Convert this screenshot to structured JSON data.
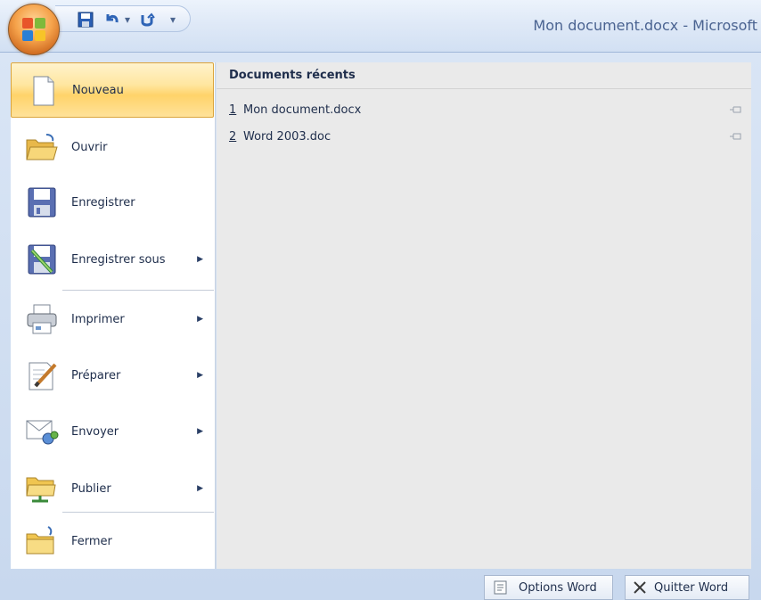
{
  "window": {
    "title": "Mon document.docx - Microsoft"
  },
  "quick_access": {
    "save_icon": "save-icon",
    "undo_icon": "undo-icon",
    "redo_icon": "redo-icon",
    "customize_icon": "dropdown-icon"
  },
  "menu": {
    "items": [
      {
        "label": "Nouveau",
        "mnemonic": "N",
        "has_submenu": false,
        "highlighted": true
      },
      {
        "label": "Ouvrir",
        "mnemonic": "O",
        "has_submenu": false,
        "highlighted": false
      },
      {
        "label": "Enregistrer",
        "mnemonic": "E",
        "has_submenu": false,
        "highlighted": false
      },
      {
        "label": "Enregistrer sous",
        "mnemonic": "s",
        "has_submenu": true,
        "highlighted": false
      },
      {
        "label": "Imprimer",
        "mnemonic": "p",
        "has_submenu": true,
        "highlighted": false
      },
      {
        "label": "Préparer",
        "mnemonic": "é",
        "has_submenu": true,
        "highlighted": false
      },
      {
        "label": "Envoyer",
        "mnemonic": "y",
        "has_submenu": true,
        "highlighted": false
      },
      {
        "label": "Publier",
        "mnemonic": "b",
        "has_submenu": true,
        "highlighted": false
      },
      {
        "label": "Fermer",
        "mnemonic": "F",
        "has_submenu": false,
        "highlighted": false
      }
    ]
  },
  "recent": {
    "heading": "Documents récents",
    "files": [
      {
        "num": "1",
        "name": "Mon document.docx"
      },
      {
        "num": "2",
        "name": "Word 2003.doc"
      }
    ]
  },
  "footer": {
    "options_label": "Options Word",
    "quit_label": "Quitter Word"
  },
  "colors": {
    "highlight": "#ffd36a",
    "frame": "#d9e5f5",
    "recent_bg": "#eaeaea"
  }
}
